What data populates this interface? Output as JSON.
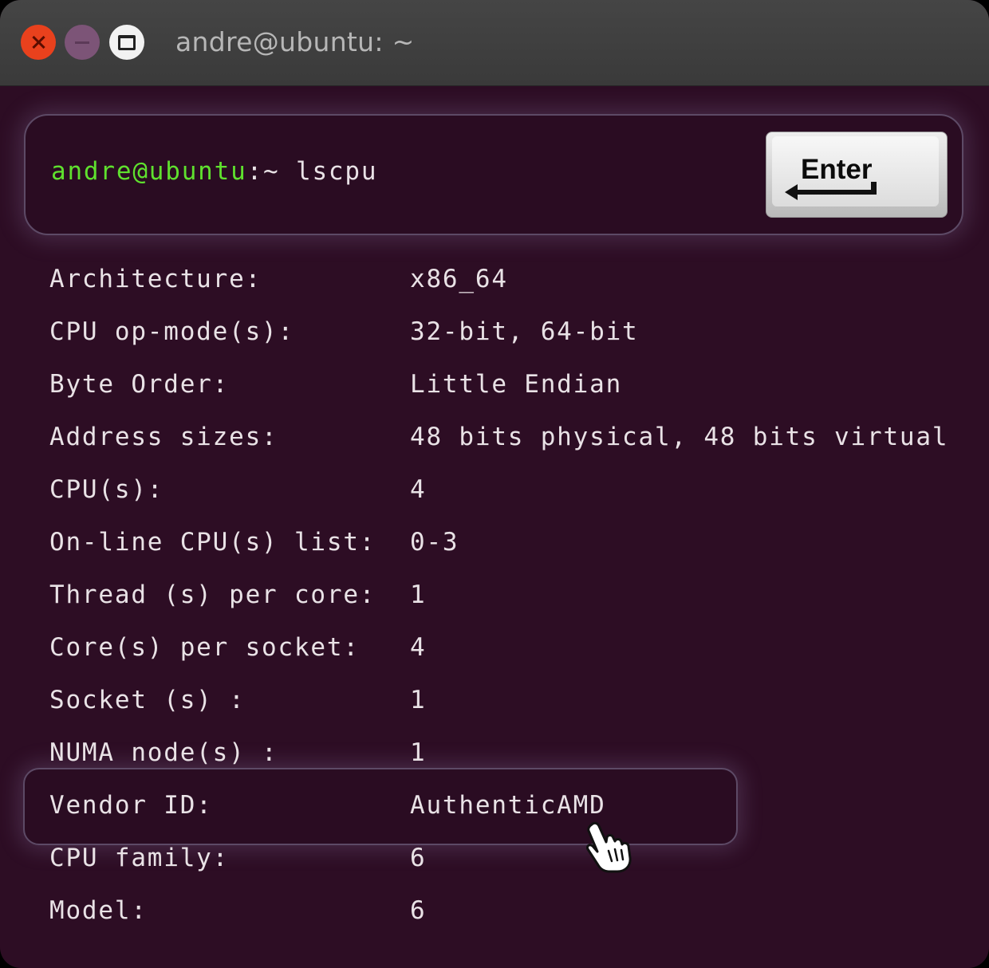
{
  "window": {
    "title": "andre@ubuntu: ~",
    "buttons": {
      "close_icon": "close-icon",
      "minimize_icon": "minimize-icon",
      "maximize_icon": "maximize-icon"
    }
  },
  "prompt": {
    "user_host": "andre@ubuntu",
    "path": ":~ ",
    "command": "lscpu"
  },
  "enter_key": {
    "label": "Enter",
    "icon": "return-arrow-icon"
  },
  "output": [
    {
      "key": "Architecture:",
      "value": "x86_64"
    },
    {
      "key": "CPU op-mode(s):",
      "value": "32-bit, 64-bit"
    },
    {
      "key": "Byte Order:",
      "value": "Little Endian"
    },
    {
      "key": "Address sizes:",
      "value": "48 bits physical, 48 bits virtual"
    },
    {
      "key": "CPU(s):",
      "value": "4"
    },
    {
      "key": "On-line CPU(s) list:",
      "value": "0-3"
    },
    {
      "key": "Thread (s) per core:",
      "value": "1"
    },
    {
      "key": "Core(s) per socket:",
      "value": "4"
    },
    {
      "key": "Socket (s) :",
      "value": "1"
    },
    {
      "key": "NUMA node(s) :",
      "value": "1"
    },
    {
      "key": "Vendor ID:",
      "value": "AuthenticAMD"
    },
    {
      "key": "CPU family:",
      "value": "6"
    },
    {
      "key": "Model:",
      "value": "6"
    }
  ],
  "highlighted_row": "Vendor ID:",
  "cursor_icon": "hand-pointer-icon",
  "colors": {
    "terminal_bg": "#2d0d24",
    "prompt_user": "#5fe12e",
    "text": "#e9e2e6",
    "close": "#e9411d",
    "minimize": "#7c5477",
    "maximize": "#f2f2f2"
  }
}
